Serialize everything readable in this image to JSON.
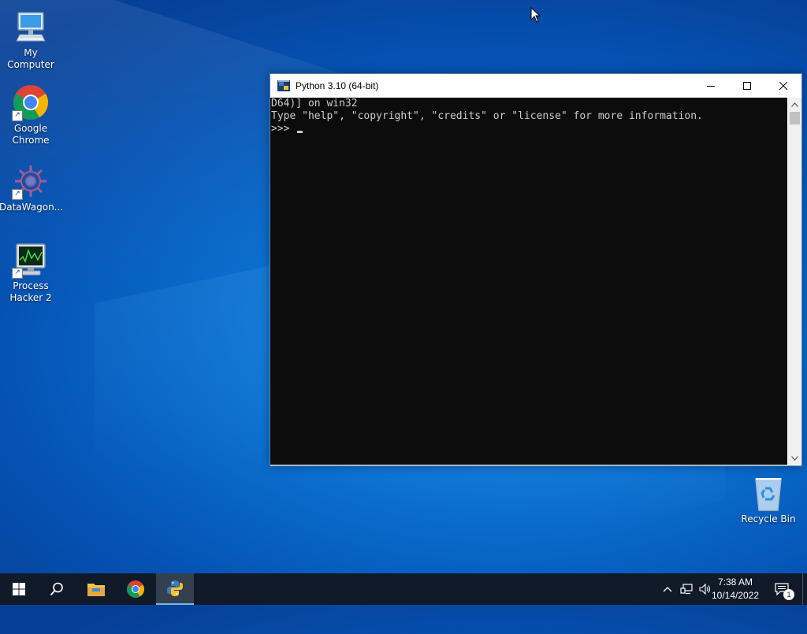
{
  "desktop": {
    "icons": [
      {
        "label": "My Computer",
        "icon": "computer-icon"
      },
      {
        "label": "Google Chrome",
        "icon": "chrome-icon"
      },
      {
        "label": "DataWagon...",
        "icon": "datawagon-icon"
      },
      {
        "label": "Process Hacker 2",
        "icon": "process-hacker-icon"
      },
      {
        "label": "Recycle Bin",
        "icon": "recycle-bin-icon"
      }
    ]
  },
  "window": {
    "title": "Python 3.10 (64-bit)",
    "console_lines": [
      "D64)] on win32",
      "Type \"help\", \"copyright\", \"credits\" or \"license\" for more information.",
      ">>> "
    ]
  },
  "taskbar": {
    "items": [
      "start-icon",
      "search-icon",
      "file-explorer-icon",
      "chrome-icon",
      "python-icon"
    ],
    "clock_time": "7:38 AM",
    "clock_date": "10/14/2022",
    "notification_count": "1",
    "tray_icons": [
      "chevron-up-icon",
      "network-icon",
      "volume-icon"
    ]
  },
  "colors": {
    "console_bg": "#0c0c0c",
    "console_fg": "#cccccc",
    "taskbar_bg": "#101a28",
    "desktop_accent": "#0a6fd0"
  }
}
